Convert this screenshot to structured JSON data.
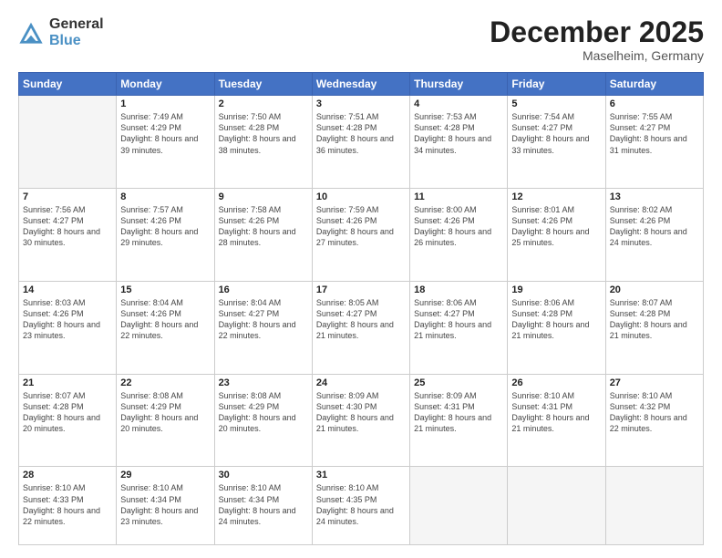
{
  "header": {
    "logo": {
      "general": "General",
      "blue": "Blue"
    },
    "title": "December 2025",
    "location": "Maselheim, Germany"
  },
  "days_of_week": [
    "Sunday",
    "Monday",
    "Tuesday",
    "Wednesday",
    "Thursday",
    "Friday",
    "Saturday"
  ],
  "weeks": [
    [
      {
        "day": "",
        "sunrise": "",
        "sunset": "",
        "daylight": ""
      },
      {
        "day": "1",
        "sunrise": "Sunrise: 7:49 AM",
        "sunset": "Sunset: 4:29 PM",
        "daylight": "Daylight: 8 hours and 39 minutes."
      },
      {
        "day": "2",
        "sunrise": "Sunrise: 7:50 AM",
        "sunset": "Sunset: 4:28 PM",
        "daylight": "Daylight: 8 hours and 38 minutes."
      },
      {
        "day": "3",
        "sunrise": "Sunrise: 7:51 AM",
        "sunset": "Sunset: 4:28 PM",
        "daylight": "Daylight: 8 hours and 36 minutes."
      },
      {
        "day": "4",
        "sunrise": "Sunrise: 7:53 AM",
        "sunset": "Sunset: 4:28 PM",
        "daylight": "Daylight: 8 hours and 34 minutes."
      },
      {
        "day": "5",
        "sunrise": "Sunrise: 7:54 AM",
        "sunset": "Sunset: 4:27 PM",
        "daylight": "Daylight: 8 hours and 33 minutes."
      },
      {
        "day": "6",
        "sunrise": "Sunrise: 7:55 AM",
        "sunset": "Sunset: 4:27 PM",
        "daylight": "Daylight: 8 hours and 31 minutes."
      }
    ],
    [
      {
        "day": "7",
        "sunrise": "Sunrise: 7:56 AM",
        "sunset": "Sunset: 4:27 PM",
        "daylight": "Daylight: 8 hours and 30 minutes."
      },
      {
        "day": "8",
        "sunrise": "Sunrise: 7:57 AM",
        "sunset": "Sunset: 4:26 PM",
        "daylight": "Daylight: 8 hours and 29 minutes."
      },
      {
        "day": "9",
        "sunrise": "Sunrise: 7:58 AM",
        "sunset": "Sunset: 4:26 PM",
        "daylight": "Daylight: 8 hours and 28 minutes."
      },
      {
        "day": "10",
        "sunrise": "Sunrise: 7:59 AM",
        "sunset": "Sunset: 4:26 PM",
        "daylight": "Daylight: 8 hours and 27 minutes."
      },
      {
        "day": "11",
        "sunrise": "Sunrise: 8:00 AM",
        "sunset": "Sunset: 4:26 PM",
        "daylight": "Daylight: 8 hours and 26 minutes."
      },
      {
        "day": "12",
        "sunrise": "Sunrise: 8:01 AM",
        "sunset": "Sunset: 4:26 PM",
        "daylight": "Daylight: 8 hours and 25 minutes."
      },
      {
        "day": "13",
        "sunrise": "Sunrise: 8:02 AM",
        "sunset": "Sunset: 4:26 PM",
        "daylight": "Daylight: 8 hours and 24 minutes."
      }
    ],
    [
      {
        "day": "14",
        "sunrise": "Sunrise: 8:03 AM",
        "sunset": "Sunset: 4:26 PM",
        "daylight": "Daylight: 8 hours and 23 minutes."
      },
      {
        "day": "15",
        "sunrise": "Sunrise: 8:04 AM",
        "sunset": "Sunset: 4:26 PM",
        "daylight": "Daylight: 8 hours and 22 minutes."
      },
      {
        "day": "16",
        "sunrise": "Sunrise: 8:04 AM",
        "sunset": "Sunset: 4:27 PM",
        "daylight": "Daylight: 8 hours and 22 minutes."
      },
      {
        "day": "17",
        "sunrise": "Sunrise: 8:05 AM",
        "sunset": "Sunset: 4:27 PM",
        "daylight": "Daylight: 8 hours and 21 minutes."
      },
      {
        "day": "18",
        "sunrise": "Sunrise: 8:06 AM",
        "sunset": "Sunset: 4:27 PM",
        "daylight": "Daylight: 8 hours and 21 minutes."
      },
      {
        "day": "19",
        "sunrise": "Sunrise: 8:06 AM",
        "sunset": "Sunset: 4:28 PM",
        "daylight": "Daylight: 8 hours and 21 minutes."
      },
      {
        "day": "20",
        "sunrise": "Sunrise: 8:07 AM",
        "sunset": "Sunset: 4:28 PM",
        "daylight": "Daylight: 8 hours and 21 minutes."
      }
    ],
    [
      {
        "day": "21",
        "sunrise": "Sunrise: 8:07 AM",
        "sunset": "Sunset: 4:28 PM",
        "daylight": "Daylight: 8 hours and 20 minutes."
      },
      {
        "day": "22",
        "sunrise": "Sunrise: 8:08 AM",
        "sunset": "Sunset: 4:29 PM",
        "daylight": "Daylight: 8 hours and 20 minutes."
      },
      {
        "day": "23",
        "sunrise": "Sunrise: 8:08 AM",
        "sunset": "Sunset: 4:29 PM",
        "daylight": "Daylight: 8 hours and 20 minutes."
      },
      {
        "day": "24",
        "sunrise": "Sunrise: 8:09 AM",
        "sunset": "Sunset: 4:30 PM",
        "daylight": "Daylight: 8 hours and 21 minutes."
      },
      {
        "day": "25",
        "sunrise": "Sunrise: 8:09 AM",
        "sunset": "Sunset: 4:31 PM",
        "daylight": "Daylight: 8 hours and 21 minutes."
      },
      {
        "day": "26",
        "sunrise": "Sunrise: 8:10 AM",
        "sunset": "Sunset: 4:31 PM",
        "daylight": "Daylight: 8 hours and 21 minutes."
      },
      {
        "day": "27",
        "sunrise": "Sunrise: 8:10 AM",
        "sunset": "Sunset: 4:32 PM",
        "daylight": "Daylight: 8 hours and 22 minutes."
      }
    ],
    [
      {
        "day": "28",
        "sunrise": "Sunrise: 8:10 AM",
        "sunset": "Sunset: 4:33 PM",
        "daylight": "Daylight: 8 hours and 22 minutes."
      },
      {
        "day": "29",
        "sunrise": "Sunrise: 8:10 AM",
        "sunset": "Sunset: 4:34 PM",
        "daylight": "Daylight: 8 hours and 23 minutes."
      },
      {
        "day": "30",
        "sunrise": "Sunrise: 8:10 AM",
        "sunset": "Sunset: 4:34 PM",
        "daylight": "Daylight: 8 hours and 24 minutes."
      },
      {
        "day": "31",
        "sunrise": "Sunrise: 8:10 AM",
        "sunset": "Sunset: 4:35 PM",
        "daylight": "Daylight: 8 hours and 24 minutes."
      },
      {
        "day": "",
        "sunrise": "",
        "sunset": "",
        "daylight": ""
      },
      {
        "day": "",
        "sunrise": "",
        "sunset": "",
        "daylight": ""
      },
      {
        "day": "",
        "sunrise": "",
        "sunset": "",
        "daylight": ""
      }
    ]
  ]
}
